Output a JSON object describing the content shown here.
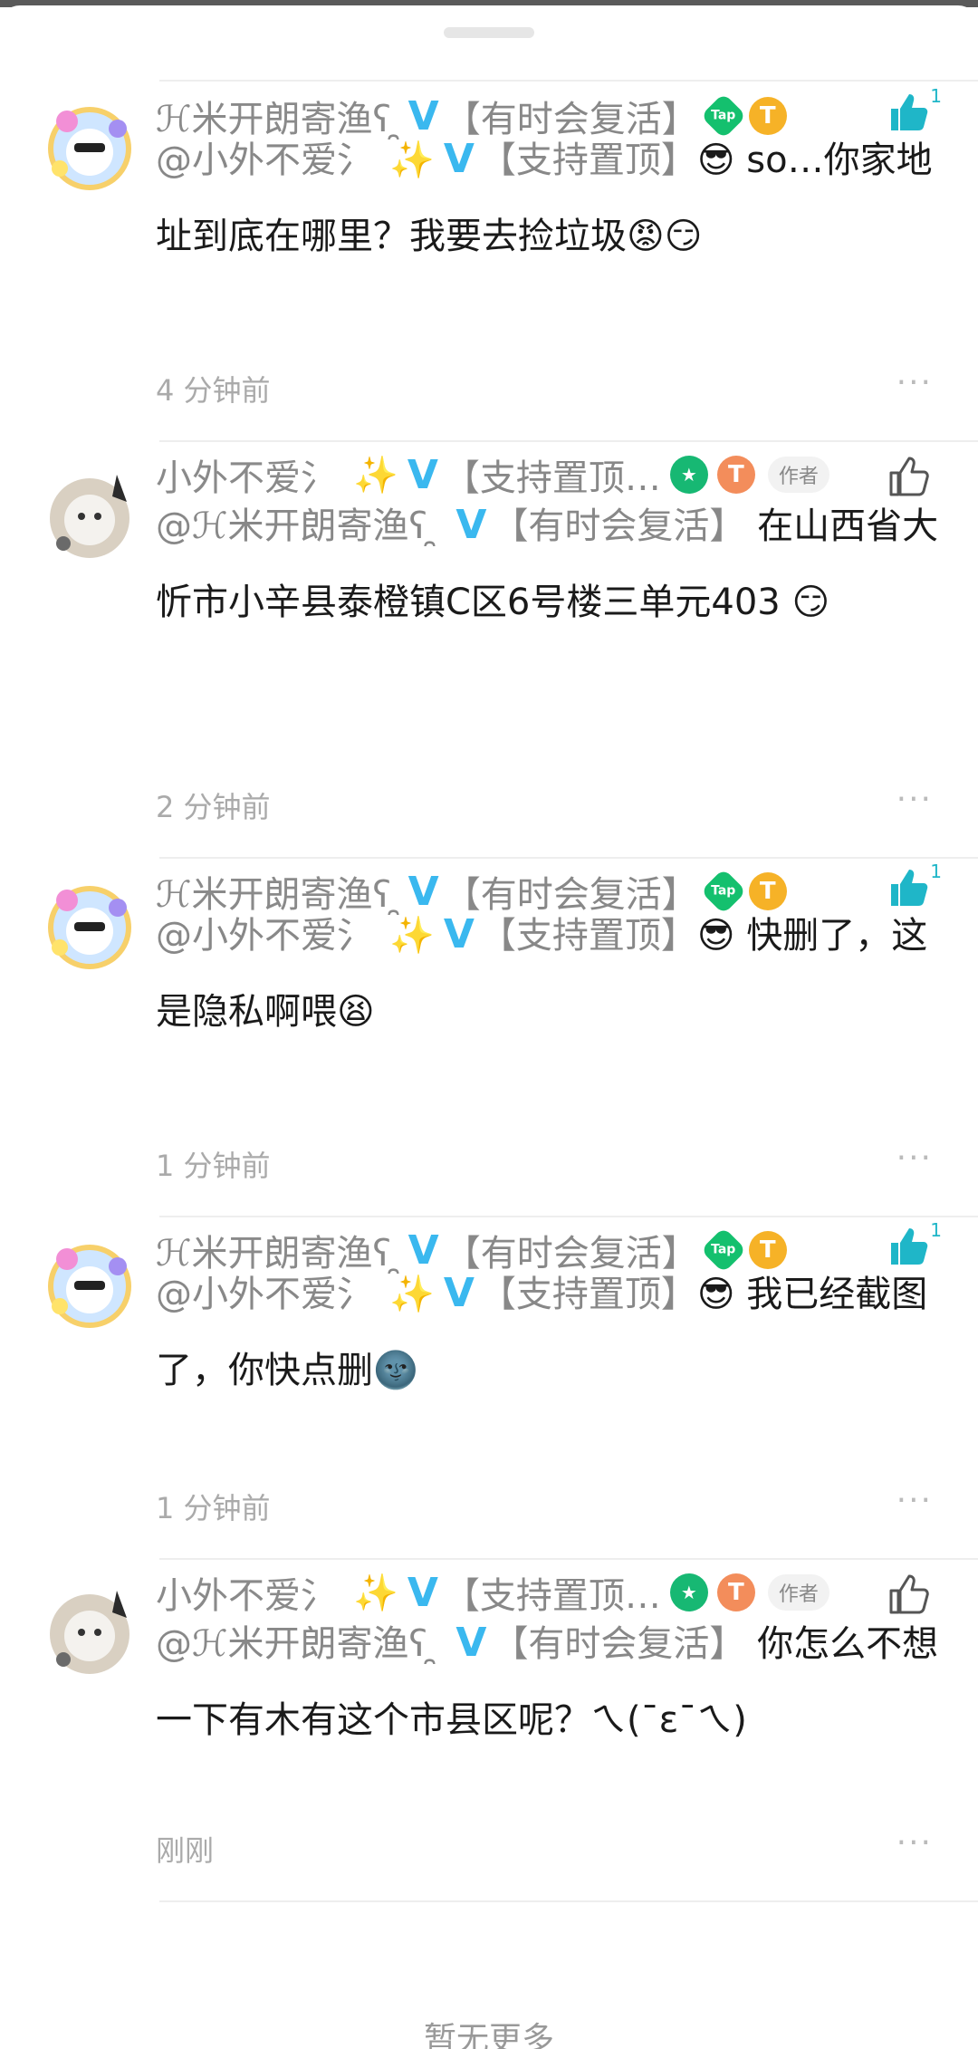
{
  "accent": "#3ab8ef",
  "comments": [
    {
      "author": "ℋ米开朗寄渔ʕ ̯ ",
      "author_tag": "【有时会复活】",
      "like_count": "1",
      "liked": true,
      "mention": "@小外不爱氵",
      "mention_tag": "【支持置顶】",
      "text": "so…你家地址到底在哪里？我要去捡垃圾",
      "emoji_prefix": "😎",
      "emoji_suffix": "😡😏",
      "time": "4 分钟前"
    },
    {
      "author": "小外不爱氵",
      "author_tag": "【支持置顶…",
      "author_badge": "作者",
      "like_count": "",
      "liked": false,
      "mention": "@ℋ米开朗寄渔ʕ ̯ ",
      "mention_tag": "【有时会复活】",
      "text": "在山西省大忻市小辛县泰橙镇C区6号楼三单元403",
      "emoji_prefix": "",
      "emoji_suffix": "😏",
      "time": "2 分钟前"
    },
    {
      "author": "ℋ米开朗寄渔ʕ ̯ ",
      "author_tag": "【有时会复活】",
      "like_count": "1",
      "liked": true,
      "mention": "@小外不爱氵",
      "mention_tag": "【支持置顶】",
      "text": "快删了，这是隐私啊喂",
      "emoji_prefix": "😎",
      "emoji_suffix": "😫",
      "time": "1 分钟前"
    },
    {
      "author": "ℋ米开朗寄渔ʕ ̯ ",
      "author_tag": "【有时会复活】",
      "like_count": "1",
      "liked": true,
      "mention": "@小外不爱氵",
      "mention_tag": "【支持置顶】",
      "text": "我已经截图了，你快点删",
      "emoji_prefix": "😎",
      "emoji_suffix": "🌚",
      "time": "1 分钟前"
    },
    {
      "author": "小外不爱氵",
      "author_tag": "【支持置顶…",
      "author_badge": "作者",
      "like_count": "",
      "liked": false,
      "mention": "@ℋ米开朗寄渔ʕ ̯ ",
      "mention_tag": "【有时会复活】",
      "text": "你怎么不想一下有木有这个市县区呢？ㄟ(¯ε¯ㄟ)",
      "emoji_prefix": "",
      "emoji_suffix": "",
      "time": "刚刚"
    }
  ],
  "footer": "暂无更多",
  "badges": {
    "vip": "V",
    "sparkle": "✨",
    "tap": "Tap",
    "gold": "T",
    "orange": "T"
  },
  "more_label": "···"
}
